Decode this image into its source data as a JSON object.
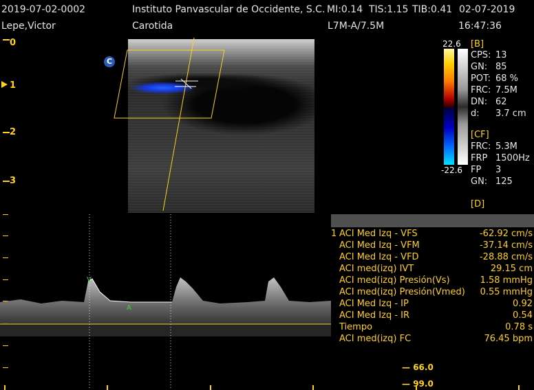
{
  "header": {
    "study_id": "2019-07-02-0002",
    "institution": "Instituto Panvascular de Occidente, S.C.",
    "mi": "MI:0.14",
    "tis": "TIS:1.15",
    "tib": "TIB:0.41",
    "date": "02-07-2019",
    "patient": "Lepe,Victor",
    "exam": "Carotida",
    "probe": "L7M-A/7.5M",
    "time": "16:47:36"
  },
  "depth_scale": [
    "0",
    "1",
    "2",
    "3"
  ],
  "image_marker": "C",
  "color_bar": {
    "top": "22.6",
    "bottom": "-22.6"
  },
  "b_params": {
    "title": "[B]",
    "rows": [
      {
        "k": "CPS:",
        "v": "13"
      },
      {
        "k": "GN:",
        "v": "85"
      },
      {
        "k": "POT:",
        "v": "68 %"
      },
      {
        "k": "FRC:",
        "v": "7.5M"
      },
      {
        "k": "DN:",
        "v": "62"
      },
      {
        "k": "d:",
        "v": "3.7 cm"
      }
    ]
  },
  "cf_params": {
    "title": "[CF]",
    "rows": [
      {
        "k": "FRC:",
        "v": "5.3M"
      },
      {
        "k": "FRP",
        "v": "1500Hz"
      },
      {
        "k": "FP",
        "v": "3"
      },
      {
        "k": "GN:",
        "v": "125"
      }
    ]
  },
  "d_params": {
    "title": "[D]"
  },
  "measurements": {
    "index": "1",
    "rows": [
      {
        "label": "ACI Med Izq - VFS",
        "value": "-62.92 cm/s"
      },
      {
        "label": "ACI Med Izq - VFM",
        "value": "-37.14 cm/s"
      },
      {
        "label": "ACI Med Izq - VFD",
        "value": "-28.88 cm/s"
      },
      {
        "label": "ACI med(izq) IVT",
        "value": "29.15 cm"
      },
      {
        "label": "ACI med(izq) Presión(Vs)",
        "value": "1.58 mmHg"
      },
      {
        "label": "ACI med(izq) Presión(Vmed)",
        "value": "0.55 mmHg"
      },
      {
        "label": "ACI Med Izq - IP",
        "value": "0.92"
      },
      {
        "label": "ACI Med Izq - IR",
        "value": "0.54"
      },
      {
        "label": "Tiempo",
        "value": "0.78 s"
      },
      {
        "label": "ACI med(izq) FC",
        "value": "76.45 bpm"
      }
    ]
  },
  "velocity_scale": [
    "66.0",
    "99.0"
  ],
  "colors": {
    "accent": "#ffd21e",
    "flow": "#1e46ff",
    "header_bg": "#505050"
  }
}
